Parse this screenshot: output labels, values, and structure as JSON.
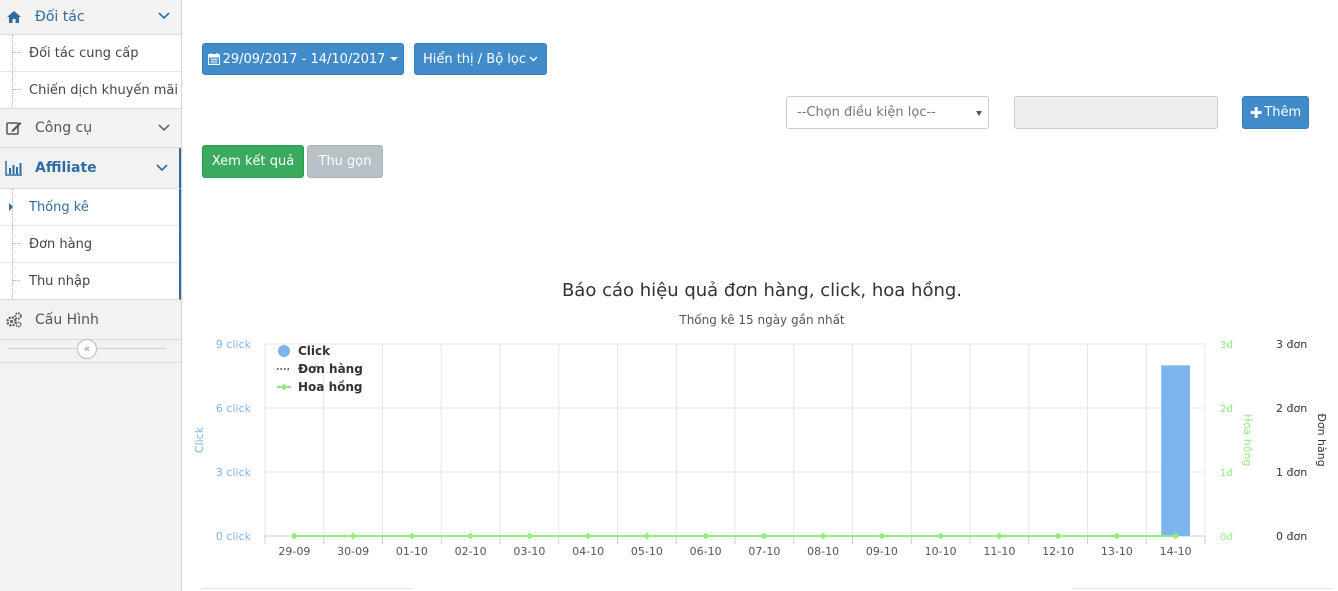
{
  "sidebar": {
    "groups": [
      {
        "label": "Đối tác",
        "icon": "home-icon"
      },
      {
        "label": "Công cụ",
        "icon": "edit-icon"
      },
      {
        "label": "Affiliate",
        "icon": "bar-chart-icon"
      },
      {
        "label": "Cấu Hình",
        "icon": "gears-icon"
      }
    ],
    "doi_tac_items": [
      "Đối tác cung cấp",
      "Chiến dịch khuyến mãi"
    ],
    "affiliate_items": [
      "Thống kê",
      "Đơn hàng",
      "Thu nhập"
    ],
    "collapse_symbol": "«"
  },
  "toolbar": {
    "date_range": "29/09/2017 - 14/10/2017",
    "display_filter": "Hiển thị / Bộ lọc",
    "filter_placeholder": "--Chọn điều kiện lọc--",
    "add_label": "Thêm",
    "view_results": "Xem kết quả",
    "collapse": "Thu gọn"
  },
  "colors": {
    "primary": "#428bca",
    "success": "#3aaa5e",
    "muted": "#b8c1c6",
    "click_series": "#7cb5ec",
    "commission_series": "#90ed7d",
    "axis_left": "#7cb5ec"
  },
  "chart_data": {
    "type": "bar",
    "title": "Báo cáo hiệu quả đơn hàng, click, hoa hồng.",
    "subtitle": "Thống kê 15 ngày gần nhất",
    "categories": [
      "29-09",
      "30-09",
      "01-10",
      "02-10",
      "03-10",
      "04-10",
      "05-10",
      "06-10",
      "07-10",
      "08-10",
      "09-10",
      "10-10",
      "11-10",
      "12-10",
      "13-10",
      "14-10"
    ],
    "series": [
      {
        "name": "Click",
        "type": "bar",
        "axis": "left",
        "values": [
          0,
          0,
          0,
          0,
          0,
          0,
          0,
          0,
          0,
          0,
          0,
          0,
          0,
          0,
          0,
          8
        ]
      },
      {
        "name": "Đơn hàng",
        "type": "line-dotted",
        "axis": "right-2",
        "values": [
          0,
          0,
          0,
          0,
          0,
          0,
          0,
          0,
          0,
          0,
          0,
          0,
          0,
          0,
          0,
          0
        ]
      },
      {
        "name": "Hoa hồng",
        "type": "line",
        "axis": "right-1",
        "values": [
          0,
          0,
          0,
          0,
          0,
          0,
          0,
          0,
          0,
          0,
          0,
          0,
          0,
          0,
          0,
          0
        ]
      }
    ],
    "axes": {
      "left": {
        "label": "Click",
        "ticks": [
          "0 click",
          "3 click",
          "6 click",
          "9 click"
        ],
        "ylim": [
          0,
          9
        ]
      },
      "right1": {
        "label": "Hoa hồng",
        "ticks": [
          "0đ",
          "1đ",
          "2đ",
          "3đ"
        ],
        "ylim": [
          0,
          3
        ]
      },
      "right2": {
        "label": "Đơn hàng",
        "ticks": [
          "0 đơn",
          "1 đơn",
          "2 đơn",
          "3 đơn"
        ],
        "ylim": [
          0,
          3
        ]
      }
    },
    "grid": true,
    "legend_position": "top-left"
  }
}
